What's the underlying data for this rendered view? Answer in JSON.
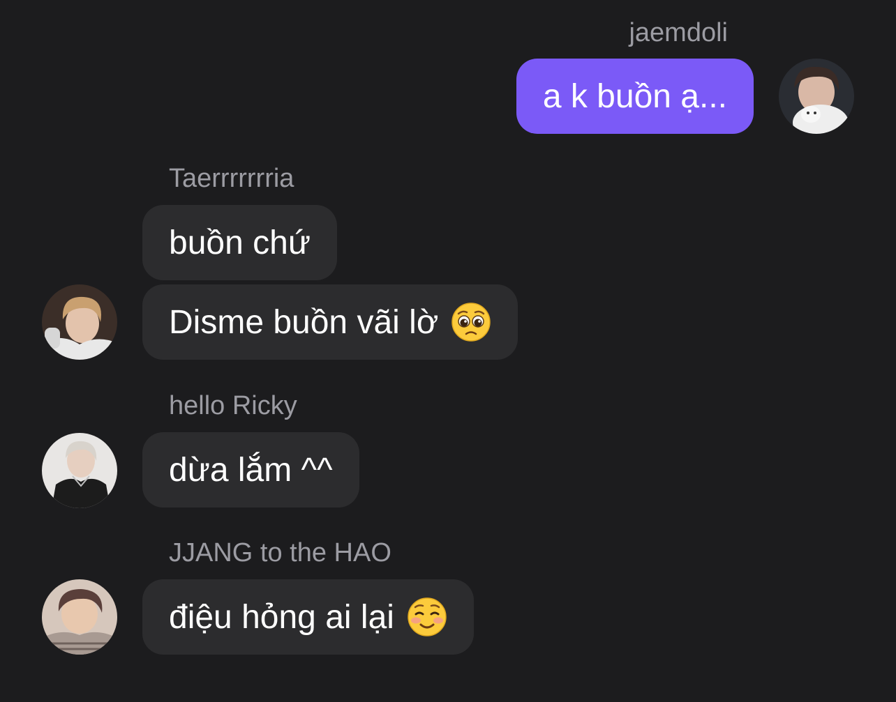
{
  "messages": [
    {
      "sender": "jaemdoli",
      "side": "out",
      "text": "a k buồn ạ...",
      "avatar": "avatar-jaemdoli"
    },
    {
      "sender": "Taerrrrrrria",
      "side": "in",
      "text": "buồn chứ"
    },
    {
      "sender": "Taerrrrrrria",
      "side": "in",
      "text": "Disme buồn vãi lờ",
      "emoji": "pleading-face-icon",
      "avatar": "avatar-taerrrrrrria"
    },
    {
      "sender": "hello Ricky",
      "side": "in",
      "text": "dừa lắm ^^",
      "avatar": "avatar-hello-ricky"
    },
    {
      "sender": "JJANG to the HAO",
      "side": "in",
      "text": "điệu hỏng ai lại",
      "emoji": "smiling-face-icon",
      "avatar": "avatar-jjang-to-the-hao"
    }
  ],
  "colors": {
    "background": "#1c1c1e",
    "incoming_bubble": "#2c2c2e",
    "outgoing_bubble": "#7b5af7",
    "sender_name": "#9c9ca3",
    "message_text": "#ffffff"
  }
}
